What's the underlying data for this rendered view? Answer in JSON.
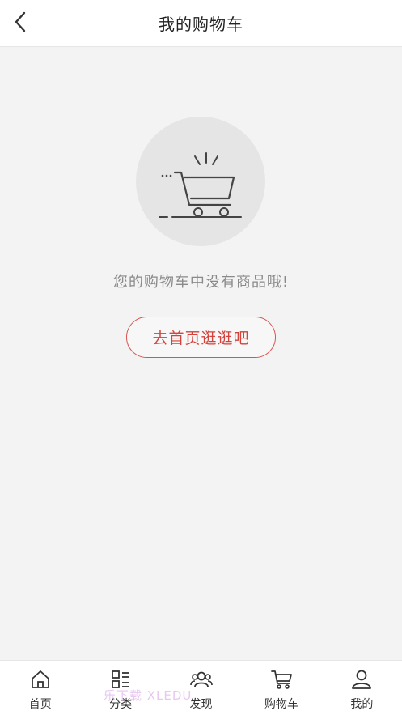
{
  "header": {
    "back_icon": "chevron-left-icon",
    "title": "我的购物车"
  },
  "empty_state": {
    "icon": "empty-cart-icon",
    "message": "您的购物车中没有商品哦!",
    "button_label": "去首页逛逛吧",
    "accent_color": "#d9534f"
  },
  "tabbar": {
    "items": [
      {
        "label": "首页",
        "icon": "home-icon"
      },
      {
        "label": "分类",
        "icon": "category-icon"
      },
      {
        "label": "发现",
        "icon": "discover-icon"
      },
      {
        "label": "购物车",
        "icon": "cart-icon"
      },
      {
        "label": "我的",
        "icon": "profile-icon"
      }
    ]
  },
  "watermark": {
    "text": "乐下载 XLEDU"
  }
}
